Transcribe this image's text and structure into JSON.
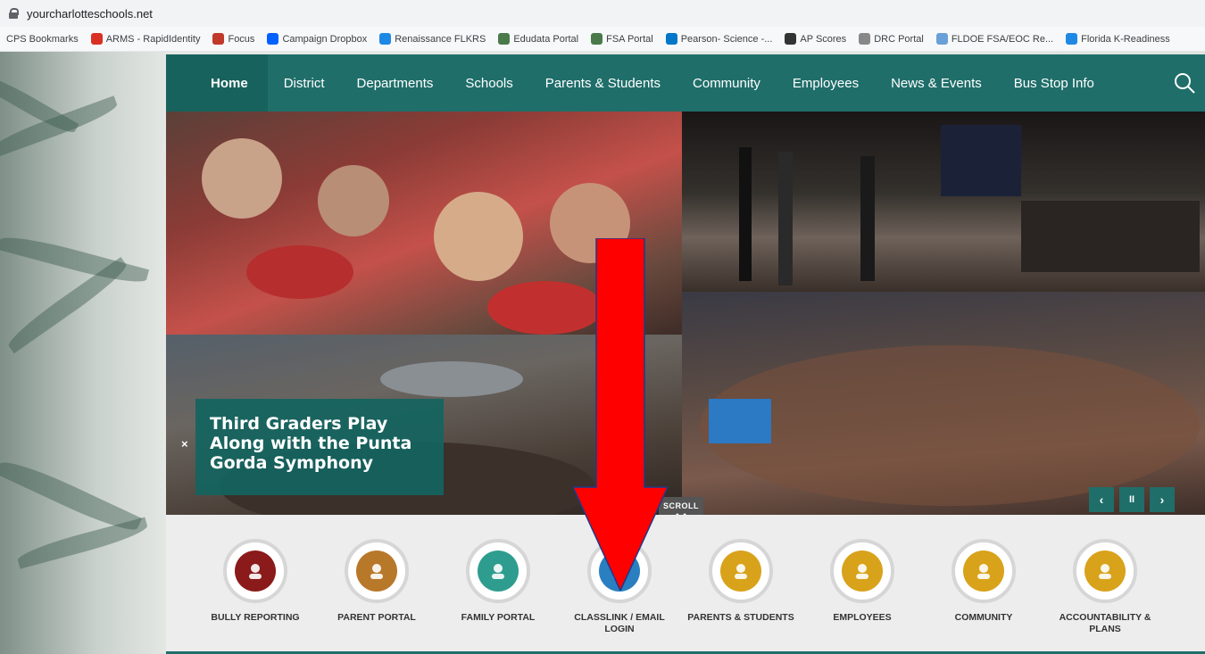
{
  "browser": {
    "url": "yourcharlotteschools.net",
    "bookmarks": [
      {
        "label": "CPS Bookmarks",
        "icon": "none",
        "color": ""
      },
      {
        "label": "ARMS - RapidIdentity",
        "icon": "arms-icon",
        "color": "#d93025"
      },
      {
        "label": "Focus",
        "icon": "focus-icon",
        "color": "#c0392b"
      },
      {
        "label": "Campaign Dropbox",
        "icon": "dropbox-icon",
        "color": "#0061ff"
      },
      {
        "label": "Renaissance FLKRS",
        "icon": "renaissance-icon",
        "color": "#1e88e5"
      },
      {
        "label": "Edudata Portal",
        "icon": "edudata-icon",
        "color": "#4a7a4a"
      },
      {
        "label": "FSA Portal",
        "icon": "fsa-icon",
        "color": "#4a7a4a"
      },
      {
        "label": "Pearson- Science -...",
        "icon": "pearson-icon",
        "color": "#0077c8"
      },
      {
        "label": "AP Scores",
        "icon": "ap-icon",
        "color": "#333333"
      },
      {
        "label": "DRC Portal",
        "icon": "drc-icon",
        "color": "#888888"
      },
      {
        "label": "FLDOE FSA/EOC Re...",
        "icon": "fldoe-icon",
        "color": "#6aa0d8"
      },
      {
        "label": "Florida K-Readiness",
        "icon": "readiness-icon",
        "color": "#1e88e5"
      }
    ]
  },
  "nav": {
    "items": [
      "Home",
      "District",
      "Departments",
      "Schools",
      "Parents & Students",
      "Community",
      "Employees",
      "News & Events",
      "Bus Stop Info"
    ],
    "active": "Home"
  },
  "hero": {
    "caption": "Third Graders Play Along with the Punta Gorda Symphony",
    "caption_close": "×",
    "prev": "‹",
    "pause": "II",
    "next": "›",
    "scroll_label": "SCROLL"
  },
  "quick_links": [
    {
      "label": "BULLY REPORTING",
      "icon": "report-bullying-icon",
      "color": "#8b1a1a"
    },
    {
      "label": "PARENT PORTAL",
      "icon": "owl-graduate-icon",
      "color": "#b8782a"
    },
    {
      "label": "FAMILY PORTAL",
      "icon": "family-owl-icon",
      "color": "#2e9d8f"
    },
    {
      "label": "CLASSLINK / EMAIL LOGIN",
      "icon": "cloud-link-icon",
      "color": "#2a7fc0"
    },
    {
      "label": "PARENTS & STUDENTS",
      "icon": "people-icon",
      "color": "#d8a21a"
    },
    {
      "label": "EMPLOYEES",
      "icon": "employees-icon",
      "color": "#d8a21a"
    },
    {
      "label": "COMMUNITY",
      "icon": "community-icon",
      "color": "#d8a21a"
    },
    {
      "label": "ACCOUNTABILITY & PLANS",
      "icon": "document-icon",
      "color": "#d8a21a"
    }
  ],
  "annotation": {
    "arrow_color": "#ff0000"
  }
}
